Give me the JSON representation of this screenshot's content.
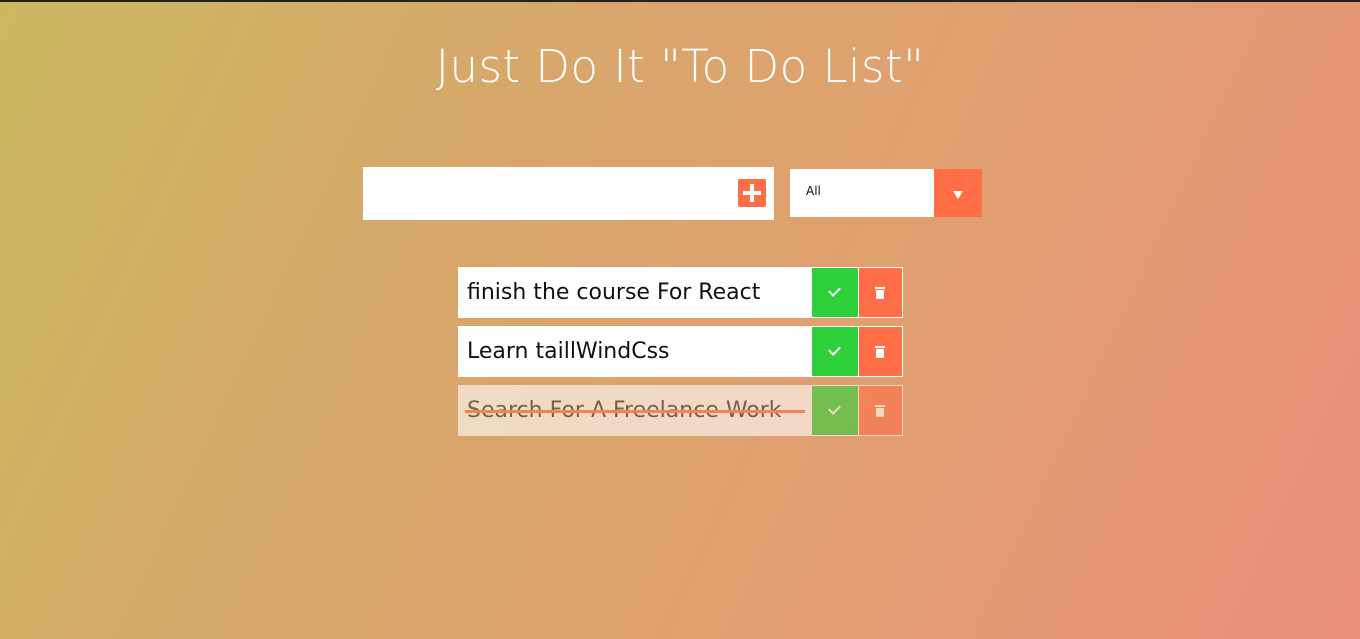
{
  "header": {
    "title": "Just Do It \"To Do List\""
  },
  "form": {
    "input_value": "",
    "input_placeholder": "",
    "add_icon": "plus-square-icon",
    "filter": {
      "selected": "All",
      "arrow_icon": "caret-down-icon"
    }
  },
  "todos": [
    {
      "text": "finish the course For React",
      "completed": false
    },
    {
      "text": "Learn taillWindCss",
      "completed": false
    },
    {
      "text": "Search For A Freelance Work",
      "completed": true
    }
  ],
  "colors": {
    "accent": "#ff6f47",
    "complete": "#2ed13a",
    "gradient_start": "#cdb860",
    "gradient_end": "#ea907a"
  }
}
